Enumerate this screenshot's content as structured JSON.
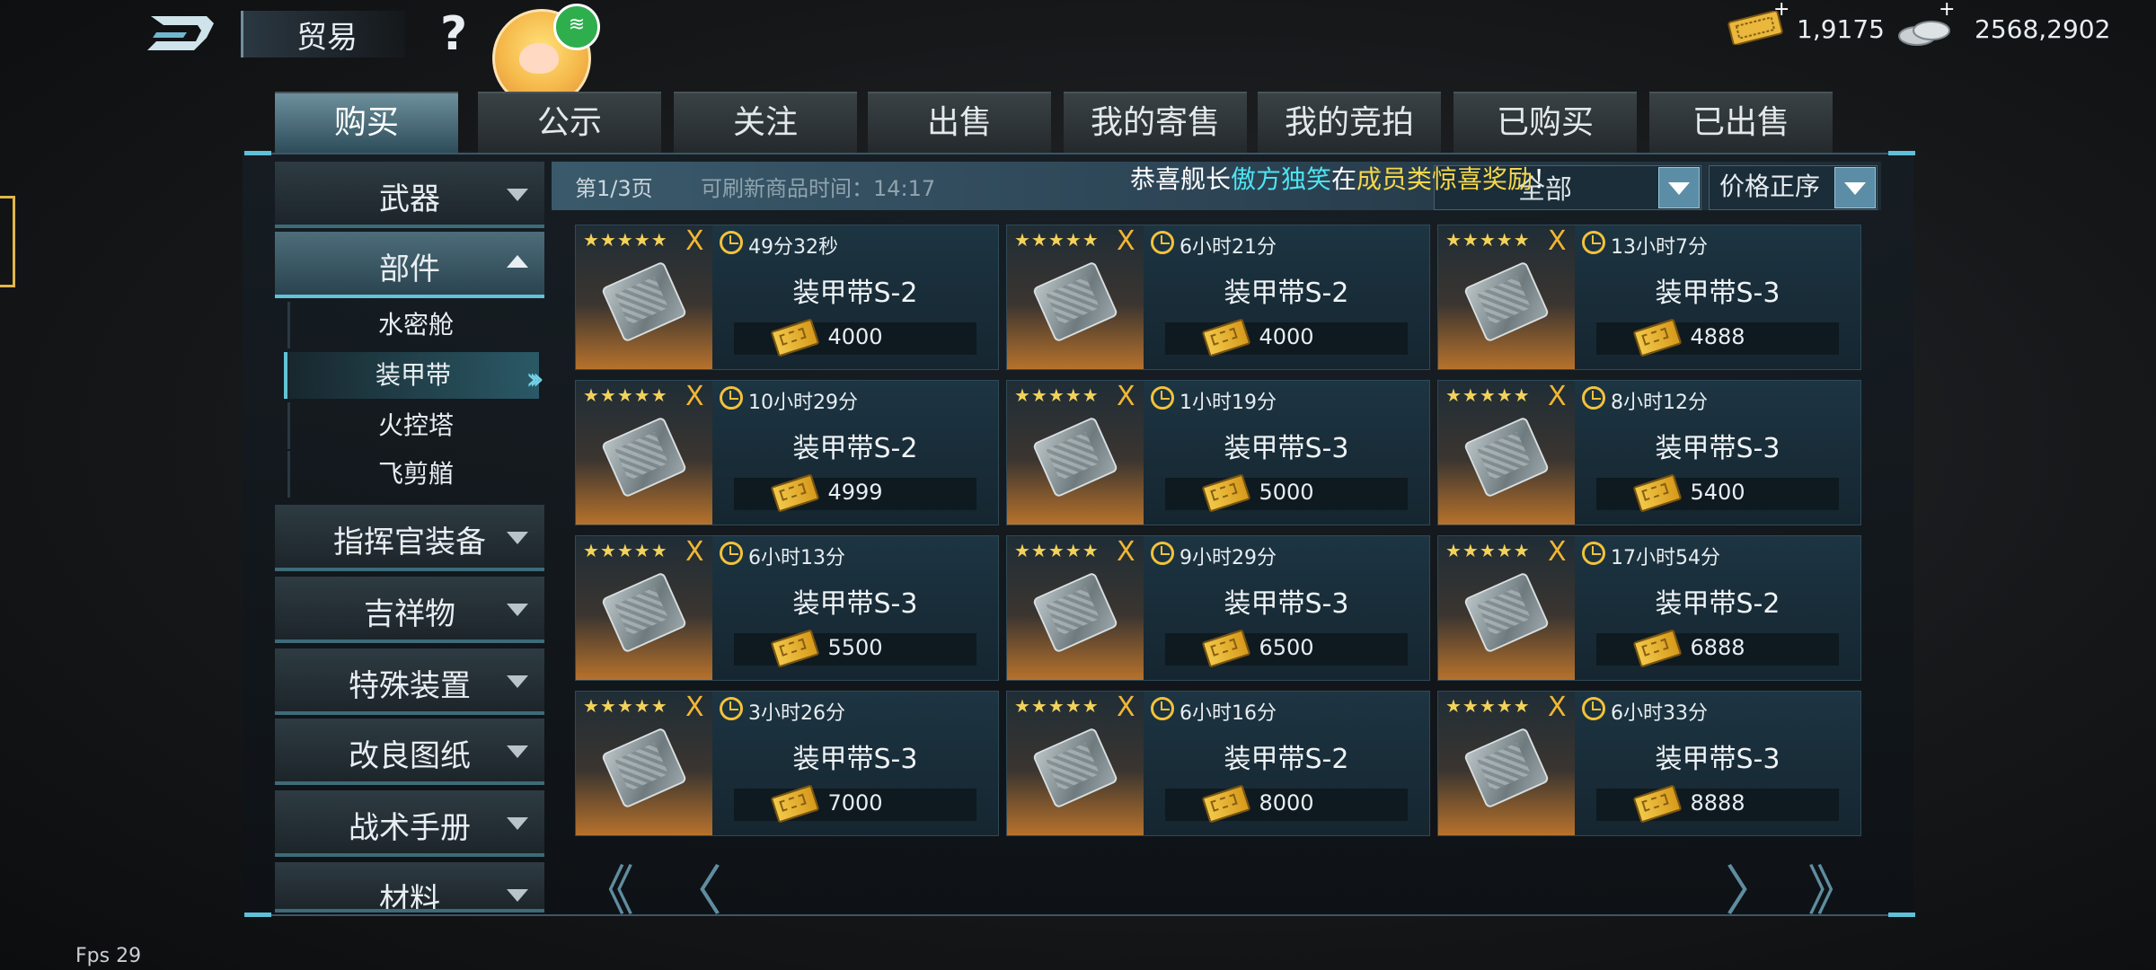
{
  "header": {
    "title": "贸易",
    "help_symbol": "?",
    "currency_ticket": "1,9175",
    "currency_coin": "2568,2902",
    "plus_symbol": "+"
  },
  "tabs": [
    {
      "label": "购买",
      "active": true
    },
    {
      "label": "公示"
    },
    {
      "label": "关注"
    },
    {
      "label": "出售"
    },
    {
      "label": "我的寄售"
    },
    {
      "label": "我的竞拍"
    },
    {
      "label": "已购买"
    },
    {
      "label": "已出售"
    }
  ],
  "sidebar": {
    "categories": [
      {
        "label": "武器"
      },
      {
        "label": "部件",
        "expanded": true
      },
      {
        "label": "指挥官装备"
      },
      {
        "label": "吉祥物"
      },
      {
        "label": "特殊装置"
      },
      {
        "label": "改良图纸"
      },
      {
        "label": "战术手册"
      },
      {
        "label": "材料"
      }
    ],
    "subitems": [
      {
        "label": "水密舱"
      },
      {
        "label": "装甲带",
        "selected": true
      },
      {
        "label": "火控塔"
      },
      {
        "label": "飞剪艏"
      }
    ]
  },
  "listing": {
    "page_label": "第1/3页",
    "refresh_label": "可刷新商品时间：14:17",
    "marquee": {
      "pre": "恭喜舰长",
      "name": "傲方独笑",
      "mid": "在",
      "reward": "成员类惊喜奖励",
      "tail": "！"
    },
    "filter_value": "全部",
    "sort_value": "价格正序"
  },
  "items": [
    {
      "stars": "★★★★★",
      "mark": "X",
      "time": "49分32秒",
      "name": "装甲带S-2",
      "price": "4000"
    },
    {
      "stars": "★★★★★",
      "mark": "X",
      "time": "6小时21分",
      "name": "装甲带S-2",
      "price": "4000"
    },
    {
      "stars": "★★★★★",
      "mark": "X",
      "time": "13小时7分",
      "name": "装甲带S-3",
      "price": "4888"
    },
    {
      "stars": "★★★★★",
      "mark": "X",
      "time": "10小时29分",
      "name": "装甲带S-2",
      "price": "4999"
    },
    {
      "stars": "★★★★★",
      "mark": "X",
      "time": "1小时19分",
      "name": "装甲带S-3",
      "price": "5000"
    },
    {
      "stars": "★★★★★",
      "mark": "X",
      "time": "8小时12分",
      "name": "装甲带S-3",
      "price": "5400"
    },
    {
      "stars": "★★★★★",
      "mark": "X",
      "time": "6小时13分",
      "name": "装甲带S-3",
      "price": "5500"
    },
    {
      "stars": "★★★★★",
      "mark": "X",
      "time": "9小时29分",
      "name": "装甲带S-3",
      "price": "6500"
    },
    {
      "stars": "★★★★★",
      "mark": "X",
      "time": "17小时54分",
      "name": "装甲带S-2",
      "price": "6888"
    },
    {
      "stars": "★★★★★",
      "mark": "X",
      "time": "3小时26分",
      "name": "装甲带S-3",
      "price": "7000"
    },
    {
      "stars": "★★★★★",
      "mark": "X",
      "time": "6小时16分",
      "name": "装甲带S-2",
      "price": "8000"
    },
    {
      "stars": "★★★★★",
      "mark": "X",
      "time": "6小时33分",
      "name": "装甲带S-3",
      "price": "8888"
    }
  ],
  "pager": {
    "first": "《",
    "prev": "〈",
    "next": "〉",
    "last": "》"
  },
  "fps": "Fps 29",
  "colors": {
    "accent": "#63c2d6",
    "gold": "#f3d25a",
    "highlight_name": "#4fe3f0",
    "highlight_reward": "#f5d84a"
  }
}
